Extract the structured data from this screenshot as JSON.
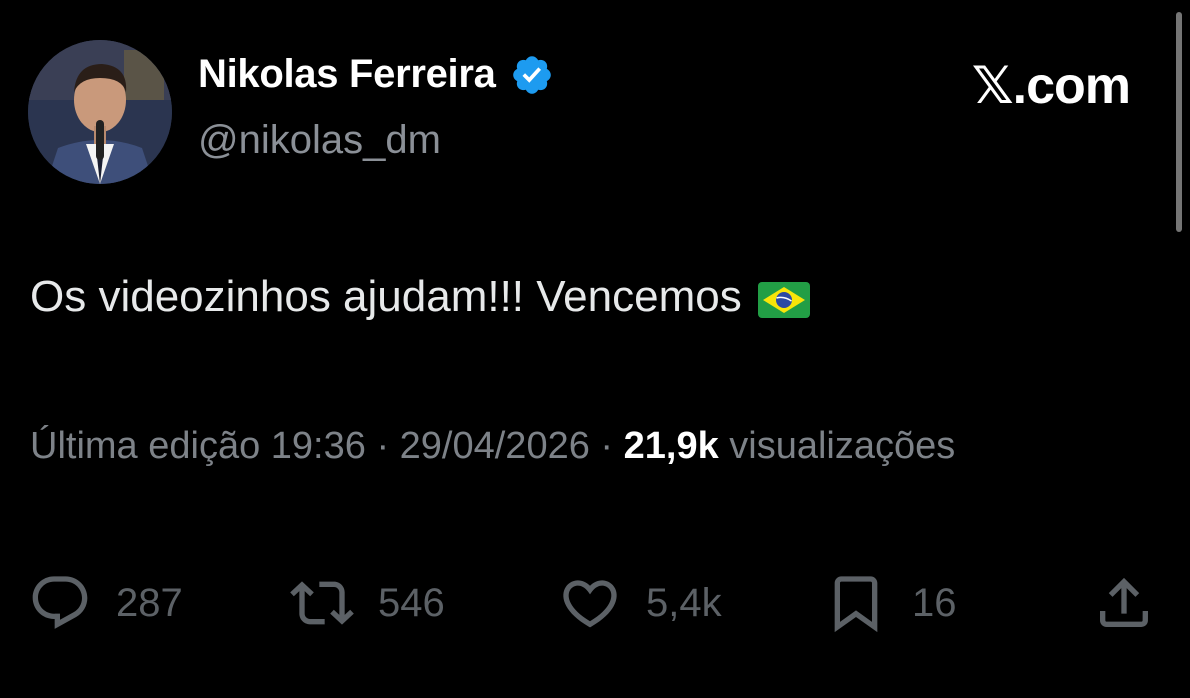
{
  "author": {
    "name": "Nikolas Ferreira",
    "handle": "@nikolas_dm",
    "verified": true,
    "avatar_icon": "profile-photo"
  },
  "brand": "𝕏.com",
  "tweet": {
    "text": "Os videozinhos ajudam!!! Vencemos",
    "emoji": "brazil-flag"
  },
  "meta": {
    "edited_prefix": "Última edição",
    "time": "19:36",
    "separator1": "·",
    "date": "29/04/2026",
    "separator2": "·",
    "views_count": "21,9k",
    "views_label": "visualizações"
  },
  "actions": {
    "replies": "287",
    "reposts": "546",
    "likes": "5,4k",
    "bookmarks": "16"
  },
  "colors": {
    "background": "#000000",
    "verified_blue": "#1d9bf0",
    "muted": "#7d8288"
  }
}
